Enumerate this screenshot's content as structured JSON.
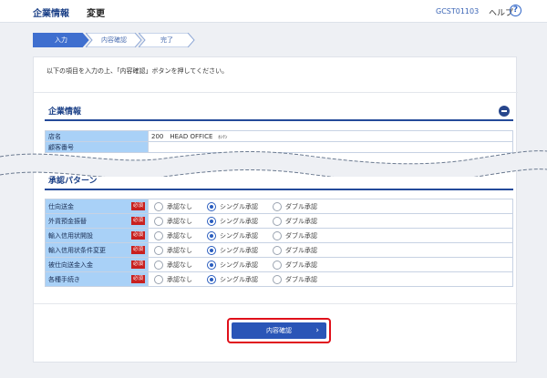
{
  "header": {
    "title": "企業情報",
    "subtitle": "変更",
    "screen_id": "GCST01103",
    "help_label": "ヘルプ"
  },
  "steps": [
    {
      "label": "入力",
      "active": true
    },
    {
      "label": "内容確認",
      "active": false
    },
    {
      "label": "完了",
      "active": false
    }
  ],
  "instruction": "以下の項目を入力の上、「内容確認」ボタンを押してください。",
  "company_section": {
    "title": "企業情報",
    "rows": [
      {
        "label": "店名",
        "value": "200　HEAD OFFICE",
        "kana": "ﾎﾝﾃﾝ"
      },
      {
        "label": "顧客番号",
        "value": ""
      }
    ]
  },
  "approval_section": {
    "title": "承認パターン",
    "required_label": "必須",
    "options": [
      "承認なし",
      "シングル承認",
      "ダブル承認"
    ],
    "rows": [
      {
        "label": "仕向送金",
        "selected": 1
      },
      {
        "label": "外貨預金振替",
        "selected": 1
      },
      {
        "label": "輸入信用状開設",
        "selected": 1
      },
      {
        "label": "輸入信用状条件変更",
        "selected": 1
      },
      {
        "label": "被仕向送金入金",
        "selected": 1
      },
      {
        "label": "各種手続き",
        "selected": 1
      }
    ]
  },
  "confirm_button": {
    "label": "内容確認"
  },
  "colors": {
    "accent": "#2a55b7",
    "required": "#c8201f",
    "label_bg": "#a9d1f7",
    "highlight": "#e0101a"
  }
}
